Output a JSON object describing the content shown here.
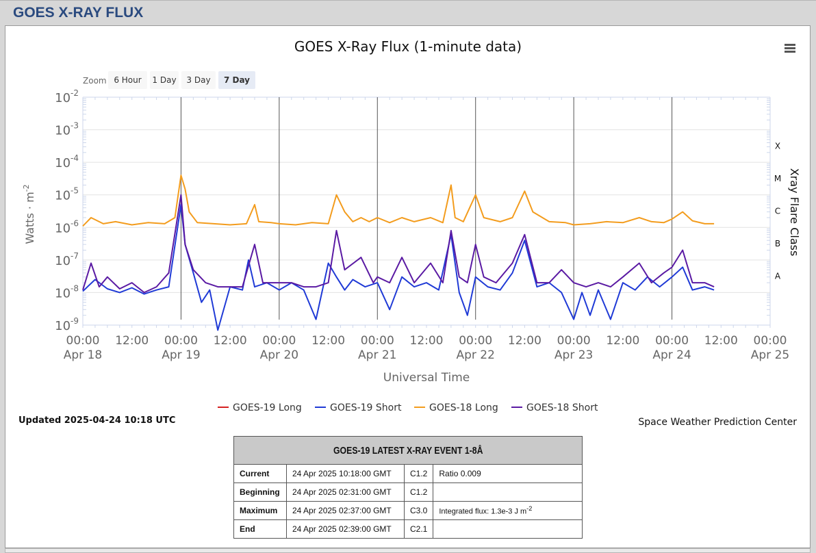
{
  "header": {
    "title": "GOES X-RAY FLUX"
  },
  "chart": {
    "title": "GOES X-Ray Flux (1-minute data)",
    "menu_icon": "hamburger-menu-icon",
    "zoom": {
      "label": "Zoom",
      "buttons": [
        "6 Hour",
        "1 Day",
        "3 Day",
        "7 Day"
      ],
      "selected": "7 Day"
    },
    "ylabel": "Watts · m",
    "ylabel_sup": "-2",
    "xlabel": "Universal Time",
    "right_label": "Xray Flare Class",
    "flare_classes": [
      "X",
      "M",
      "C",
      "B",
      "A"
    ],
    "updated": "Updated 2025-04-24 10:18 UTC",
    "credit": "Space Weather Prediction Center"
  },
  "chart_data": {
    "type": "line",
    "y_scale": "log",
    "ylim": [
      1e-09,
      0.01
    ],
    "y_ticks": [
      {
        "base": "10",
        "exp": "-2"
      },
      {
        "base": "10",
        "exp": "-3"
      },
      {
        "base": "10",
        "exp": "-4"
      },
      {
        "base": "10",
        "exp": "-5"
      },
      {
        "base": "10",
        "exp": "-6"
      },
      {
        "base": "10",
        "exp": "-7"
      },
      {
        "base": "10",
        "exp": "-8"
      },
      {
        "base": "10",
        "exp": "-9"
      }
    ],
    "x_range": [
      "2025-04-18 00:00",
      "2025-04-25 00:00"
    ],
    "x_ticks": [
      {
        "time": "00:00",
        "date": "Apr 18"
      },
      {
        "time": "12:00",
        "date": ""
      },
      {
        "time": "00:00",
        "date": "Apr 19"
      },
      {
        "time": "12:00",
        "date": ""
      },
      {
        "time": "00:00",
        "date": "Apr 20"
      },
      {
        "time": "12:00",
        "date": ""
      },
      {
        "time": "00:00",
        "date": "Apr 21"
      },
      {
        "time": "12:00",
        "date": ""
      },
      {
        "time": "00:00",
        "date": "Apr 22"
      },
      {
        "time": "12:00",
        "date": ""
      },
      {
        "time": "00:00",
        "date": "Apr 23"
      },
      {
        "time": "12:00",
        "date": ""
      },
      {
        "time": "00:00",
        "date": "Apr 24"
      },
      {
        "time": "12:00",
        "date": ""
      },
      {
        "time": "00:00",
        "date": "Apr 25"
      }
    ],
    "grid": "horizontal",
    "legend_position": "bottom",
    "series": [
      {
        "name": "GOES-19 Long",
        "color": "#d62020",
        "points": []
      },
      {
        "name": "GOES-19 Short",
        "color": "#1f3ad6",
        "points": [
          [
            "2025-04-18 00:00",
            1.1e-08
          ],
          [
            "2025-04-18 03:00",
            2.5e-08
          ],
          [
            "2025-04-18 06:00",
            1.3e-08
          ],
          [
            "2025-04-18 09:00",
            1e-08
          ],
          [
            "2025-04-18 12:00",
            1.4e-08
          ],
          [
            "2025-04-18 15:00",
            9e-09
          ],
          [
            "2025-04-18 18:00",
            1.2e-08
          ],
          [
            "2025-04-18 21:00",
            1.5e-08
          ],
          [
            "2025-04-19 00:00",
            5e-06
          ],
          [
            "2025-04-19 01:00",
            3e-07
          ],
          [
            "2025-04-19 03:00",
            4e-08
          ],
          [
            "2025-04-19 05:00",
            5e-09
          ],
          [
            "2025-04-19 07:00",
            1.2e-08
          ],
          [
            "2025-04-19 09:00",
            7e-10
          ],
          [
            "2025-04-19 12:00",
            1.5e-08
          ],
          [
            "2025-04-19 15:00",
            1.2e-08
          ],
          [
            "2025-04-19 16:30",
            1e-07
          ],
          [
            "2025-04-19 18:00",
            1.5e-08
          ],
          [
            "2025-04-19 21:00",
            2e-08
          ],
          [
            "2025-04-20 00:00",
            1.2e-08
          ],
          [
            "2025-04-20 03:00",
            2e-08
          ],
          [
            "2025-04-20 06:00",
            1.2e-08
          ],
          [
            "2025-04-20 09:00",
            1.5e-09
          ],
          [
            "2025-04-20 12:00",
            8e-08
          ],
          [
            "2025-04-20 14:00",
            3e-08
          ],
          [
            "2025-04-20 16:00",
            1.2e-08
          ],
          [
            "2025-04-20 18:00",
            2.5e-08
          ],
          [
            "2025-04-20 21:00",
            1.5e-08
          ],
          [
            "2025-04-21 00:00",
            2e-08
          ],
          [
            "2025-04-21 03:00",
            3e-09
          ],
          [
            "2025-04-21 06:00",
            3e-08
          ],
          [
            "2025-04-21 09:00",
            1.5e-08
          ],
          [
            "2025-04-21 12:00",
            2e-08
          ],
          [
            "2025-04-21 15:00",
            1.2e-08
          ],
          [
            "2025-04-21 18:00",
            6e-07
          ],
          [
            "2025-04-21 20:00",
            1e-08
          ],
          [
            "2025-04-21 22:00",
            2e-09
          ],
          [
            "2025-04-22 00:00",
            3e-08
          ],
          [
            "2025-04-22 03:00",
            1.5e-08
          ],
          [
            "2025-04-22 06:00",
            1.2e-08
          ],
          [
            "2025-04-22 09:00",
            4e-08
          ],
          [
            "2025-04-22 12:00",
            4e-07
          ],
          [
            "2025-04-22 15:00",
            1.5e-08
          ],
          [
            "2025-04-22 18:00",
            2e-08
          ],
          [
            "2025-04-22 21:00",
            1e-08
          ],
          [
            "2025-04-23 00:00",
            1.5e-09
          ],
          [
            "2025-04-23 02:00",
            1e-08
          ],
          [
            "2025-04-23 04:00",
            2e-09
          ],
          [
            "2025-04-23 06:00",
            1.2e-08
          ],
          [
            "2025-04-23 09:00",
            1.5e-09
          ],
          [
            "2025-04-23 12:00",
            2e-08
          ],
          [
            "2025-04-23 15:00",
            1.2e-08
          ],
          [
            "2025-04-23 18:00",
            3e-08
          ],
          [
            "2025-04-23 21:00",
            1.5e-08
          ],
          [
            "2025-04-24 00:00",
            3e-08
          ],
          [
            "2025-04-24 02:37",
            6e-08
          ],
          [
            "2025-04-24 05:00",
            1.2e-08
          ],
          [
            "2025-04-24 08:00",
            1.5e-08
          ],
          [
            "2025-04-24 10:18",
            1.2e-08
          ]
        ]
      },
      {
        "name": "GOES-18 Long",
        "color": "#f39c1d",
        "points": [
          [
            "2025-04-18 00:00",
            1.1e-06
          ],
          [
            "2025-04-18 02:00",
            2e-06
          ],
          [
            "2025-04-18 05:00",
            1.3e-06
          ],
          [
            "2025-04-18 08:00",
            1.5e-06
          ],
          [
            "2025-04-18 12:00",
            1.2e-06
          ],
          [
            "2025-04-18 16:00",
            1.4e-06
          ],
          [
            "2025-04-18 20:00",
            1.3e-06
          ],
          [
            "2025-04-18 22:30",
            2e-06
          ],
          [
            "2025-04-19 00:00",
            4e-05
          ],
          [
            "2025-04-19 01:00",
            1.5e-05
          ],
          [
            "2025-04-19 02:00",
            3e-06
          ],
          [
            "2025-04-19 04:00",
            1.4e-06
          ],
          [
            "2025-04-19 08:00",
            1.3e-06
          ],
          [
            "2025-04-19 12:00",
            1.2e-06
          ],
          [
            "2025-04-19 16:00",
            1.3e-06
          ],
          [
            "2025-04-19 18:00",
            5e-06
          ],
          [
            "2025-04-19 19:00",
            1.5e-06
          ],
          [
            "2025-04-19 22:00",
            1.4e-06
          ],
          [
            "2025-04-20 00:00",
            1.3e-06
          ],
          [
            "2025-04-20 04:00",
            1.2e-06
          ],
          [
            "2025-04-20 08:00",
            1.4e-06
          ],
          [
            "2025-04-20 12:00",
            1.3e-06
          ],
          [
            "2025-04-20 14:00",
            1e-05
          ],
          [
            "2025-04-20 16:00",
            3e-06
          ],
          [
            "2025-04-20 18:00",
            1.5e-06
          ],
          [
            "2025-04-20 20:00",
            2e-06
          ],
          [
            "2025-04-20 22:00",
            1.5e-06
          ],
          [
            "2025-04-21 00:00",
            2e-06
          ],
          [
            "2025-04-21 03:00",
            1.4e-06
          ],
          [
            "2025-04-21 06:00",
            2e-06
          ],
          [
            "2025-04-21 09:00",
            1.5e-06
          ],
          [
            "2025-04-21 13:00",
            2e-06
          ],
          [
            "2025-04-21 16:00",
            1.4e-06
          ],
          [
            "2025-04-21 18:00",
            2e-05
          ],
          [
            "2025-04-21 19:00",
            2e-06
          ],
          [
            "2025-04-21 21:00",
            1.5e-06
          ],
          [
            "2025-04-22 00:00",
            1e-05
          ],
          [
            "2025-04-22 02:00",
            2e-06
          ],
          [
            "2025-04-22 06:00",
            1.5e-06
          ],
          [
            "2025-04-22 09:00",
            2e-06
          ],
          [
            "2025-04-22 12:00",
            1.3e-05
          ],
          [
            "2025-04-22 14:00",
            3e-06
          ],
          [
            "2025-04-22 18:00",
            1.5e-06
          ],
          [
            "2025-04-22 22:00",
            1.4e-06
          ],
          [
            "2025-04-23 00:00",
            1.2e-06
          ],
          [
            "2025-04-23 04:00",
            1.3e-06
          ],
          [
            "2025-04-23 08:00",
            1.5e-06
          ],
          [
            "2025-04-23 12:00",
            1.4e-06
          ],
          [
            "2025-04-23 16:00",
            2e-06
          ],
          [
            "2025-04-23 19:00",
            1.5e-06
          ],
          [
            "2025-04-23 22:00",
            1.4e-06
          ],
          [
            "2025-04-24 00:00",
            1.8e-06
          ],
          [
            "2025-04-24 02:37",
            3e-06
          ],
          [
            "2025-04-24 05:00",
            1.6e-06
          ],
          [
            "2025-04-24 08:00",
            1.3e-06
          ],
          [
            "2025-04-24 10:18",
            1.3e-06
          ]
        ]
      },
      {
        "name": "GOES-18 Short",
        "color": "#5a1aa3",
        "points": [
          [
            "2025-04-18 00:00",
            1.2e-08
          ],
          [
            "2025-04-18 02:00",
            8e-08
          ],
          [
            "2025-04-18 04:00",
            1.5e-08
          ],
          [
            "2025-04-18 06:00",
            3e-08
          ],
          [
            "2025-04-18 09:00",
            1.3e-08
          ],
          [
            "2025-04-18 12:00",
            2e-08
          ],
          [
            "2025-04-18 15:00",
            1e-08
          ],
          [
            "2025-04-18 18:00",
            1.5e-08
          ],
          [
            "2025-04-18 21:00",
            4e-08
          ],
          [
            "2025-04-19 00:00",
            1e-05
          ],
          [
            "2025-04-19 01:00",
            3e-07
          ],
          [
            "2025-04-19 03:00",
            5e-08
          ],
          [
            "2025-04-19 06:00",
            2e-08
          ],
          [
            "2025-04-19 09:00",
            1.5e-08
          ],
          [
            "2025-04-19 12:00",
            1.5e-08
          ],
          [
            "2025-04-19 15:00",
            1.5e-08
          ],
          [
            "2025-04-19 18:00",
            3e-07
          ],
          [
            "2025-04-19 20:00",
            2e-08
          ],
          [
            "2025-04-20 00:00",
            2e-08
          ],
          [
            "2025-04-20 03:00",
            2e-08
          ],
          [
            "2025-04-20 06:00",
            1.5e-08
          ],
          [
            "2025-04-20 09:00",
            1.5e-08
          ],
          [
            "2025-04-20 12:00",
            2e-08
          ],
          [
            "2025-04-20 14:00",
            8e-07
          ],
          [
            "2025-04-20 16:00",
            5e-08
          ],
          [
            "2025-04-20 20:00",
            1.2e-07
          ],
          [
            "2025-04-20 23:00",
            2e-08
          ],
          [
            "2025-04-21 00:00",
            3e-08
          ],
          [
            "2025-04-21 03:00",
            2e-08
          ],
          [
            "2025-04-21 06:00",
            1.2e-07
          ],
          [
            "2025-04-21 09:00",
            2e-08
          ],
          [
            "2025-04-21 13:00",
            8e-08
          ],
          [
            "2025-04-21 16:00",
            2e-08
          ],
          [
            "2025-04-21 18:00",
            8e-07
          ],
          [
            "2025-04-21 20:00",
            3e-08
          ],
          [
            "2025-04-21 22:00",
            2e-08
          ],
          [
            "2025-04-22 00:00",
            3e-07
          ],
          [
            "2025-04-22 02:00",
            3e-08
          ],
          [
            "2025-04-22 05:00",
            2e-08
          ],
          [
            "2025-04-22 09:00",
            8e-08
          ],
          [
            "2025-04-22 12:00",
            6e-07
          ],
          [
            "2025-04-22 15:00",
            2e-08
          ],
          [
            "2025-04-22 18:00",
            2e-08
          ],
          [
            "2025-04-22 21:00",
            5e-08
          ],
          [
            "2025-04-23 00:00",
            2e-08
          ],
          [
            "2025-04-23 03:00",
            1.5e-08
          ],
          [
            "2025-04-23 06:00",
            2e-08
          ],
          [
            "2025-04-23 09:00",
            1.5e-08
          ],
          [
            "2025-04-23 12:00",
            3e-08
          ],
          [
            "2025-04-23 16:00",
            8e-08
          ],
          [
            "2025-04-23 19:00",
            2e-08
          ],
          [
            "2025-04-23 22:00",
            4e-08
          ],
          [
            "2025-04-24 00:00",
            6e-08
          ],
          [
            "2025-04-24 02:37",
            2e-07
          ],
          [
            "2025-04-24 05:00",
            2e-08
          ],
          [
            "2025-04-24 08:00",
            2e-08
          ],
          [
            "2025-04-24 10:18",
            1.5e-08
          ]
        ]
      }
    ]
  },
  "event_table": {
    "title": "GOES-19 LATEST X-RAY EVENT 1-8Å",
    "rows": [
      {
        "label": "Current",
        "time": "24 Apr 2025 10:18:00 GMT",
        "class": "C1.2",
        "extra": "Ratio 0.009",
        "extra_sup": ""
      },
      {
        "label": "Beginning",
        "time": "24 Apr 2025 02:31:00 GMT",
        "class": "C1.2",
        "extra": "",
        "extra_sup": ""
      },
      {
        "label": "Maximum",
        "time": "24 Apr 2025 02:37:00 GMT",
        "class": "C3.0",
        "extra": "Integrated flux: 1.3e-3 J m",
        "extra_sup": "-2"
      },
      {
        "label": "End",
        "time": "24 Apr 2025 02:39:00 GMT",
        "class": "C2.1",
        "extra": "",
        "extra_sup": ""
      }
    ]
  }
}
